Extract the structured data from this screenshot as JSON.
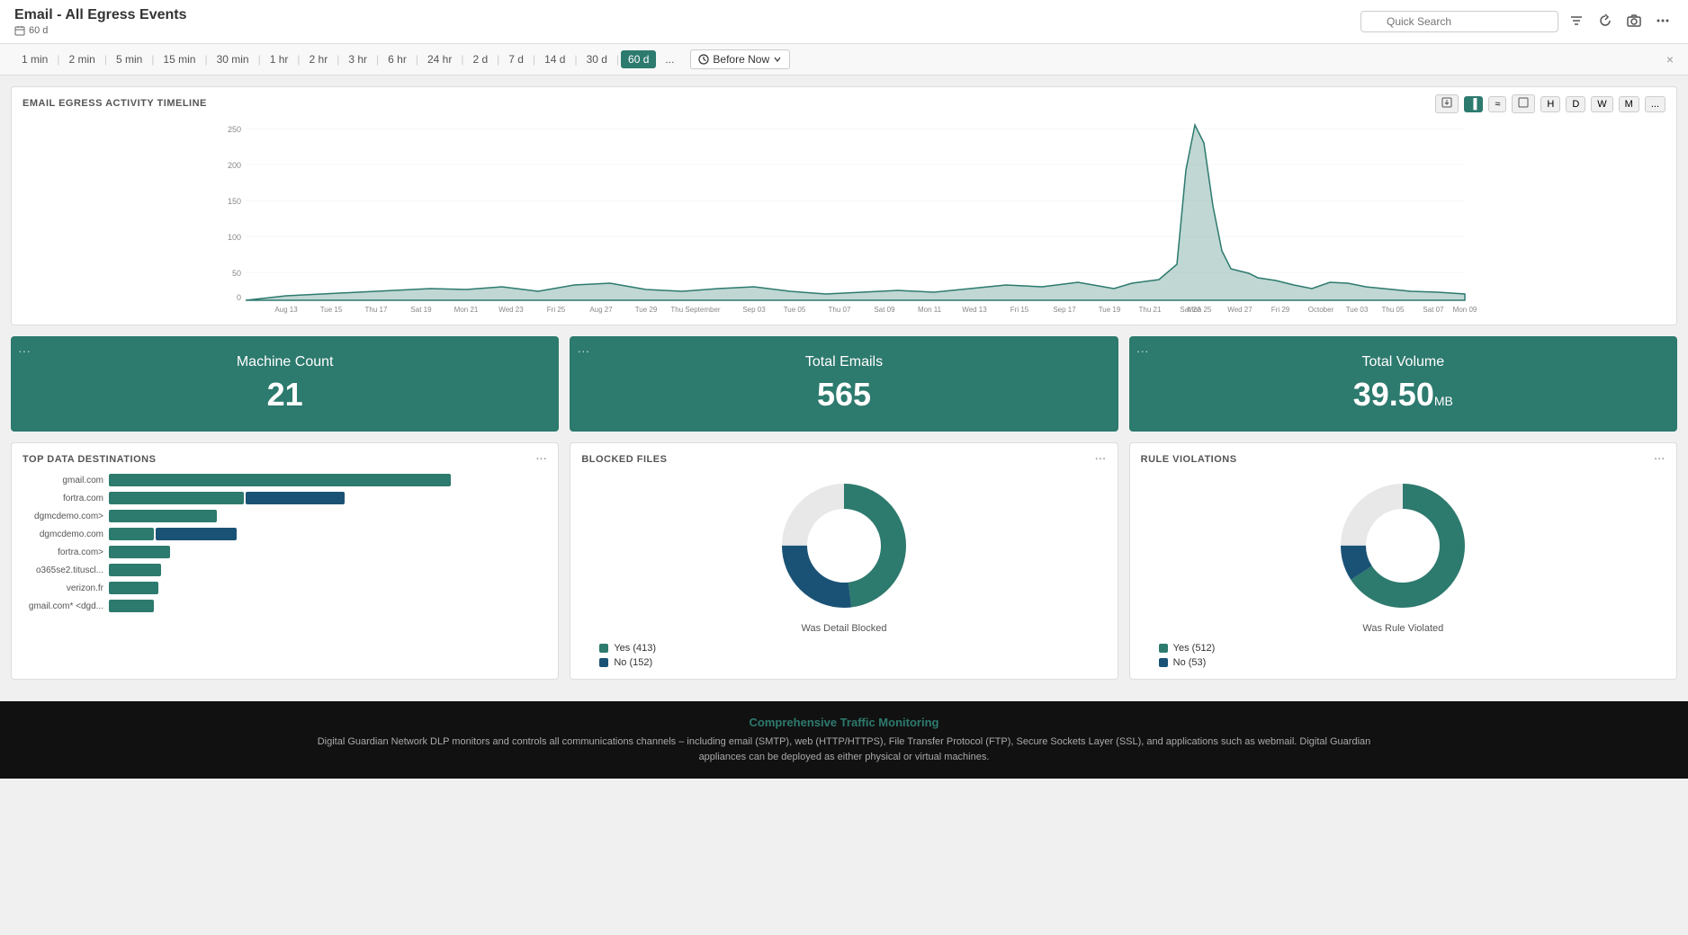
{
  "header": {
    "title": "Email - All Egress Events",
    "subtitle": "60 d",
    "search_placeholder": "Quick Search",
    "icons": [
      "filter-icon",
      "refresh-icon",
      "camera-icon",
      "more-icon"
    ]
  },
  "timebar": {
    "buttons": [
      "1 min",
      "2 min",
      "5 min",
      "15 min",
      "30 min",
      "1 hr",
      "2 hr",
      "3 hr",
      "6 hr",
      "24 hr",
      "2 d",
      "7 d",
      "14 d",
      "30 d",
      "60 d"
    ],
    "active": "60 d",
    "more_label": "...",
    "before_now_label": "Before Now",
    "close_label": "×"
  },
  "timeline_chart": {
    "title": "EMAIL EGRESS ACTIVITY TIMELINE",
    "y_labels": [
      "250",
      "200",
      "150",
      "100",
      "50",
      "0"
    ],
    "x_labels": [
      "Aug 13",
      "Tue 15",
      "Thu 17",
      "Sat 19",
      "Mon 21",
      "Wed 23",
      "Fri 25",
      "Aug 27",
      "Tue 29",
      "Thu September",
      "Sep 03",
      "Tue 05",
      "Thu 07",
      "Sat 09",
      "Mon 11",
      "Wed 13",
      "Fri 15",
      "Sep 17",
      "Tue 19",
      "Thu 21",
      "Sat 23",
      "Mon 25",
      "Wed 27",
      "Fri 29",
      "October",
      "Tue 03",
      "Thu 05",
      "Sat 07",
      "Mon 09"
    ],
    "controls": {
      "btns": [
        "H",
        "D",
        "W",
        "M"
      ],
      "active": "H"
    }
  },
  "stats": [
    {
      "label": "Machine Count",
      "value": "21",
      "unit": ""
    },
    {
      "label": "Total Emails",
      "value": "565",
      "unit": ""
    },
    {
      "label": "Total Volume",
      "value": "39.50",
      "unit": "MB"
    }
  ],
  "panels": {
    "destinations": {
      "title": "TOP DATA DESTINATIONS",
      "bars": [
        {
          "label": "gmail.com",
          "teal": 85,
          "blue": 0
        },
        {
          "label": "fortra.com",
          "teal": 35,
          "blue": 25
        },
        {
          "label": "dgmcdemo.com>",
          "teal": 28,
          "blue": 0
        },
        {
          "label": "dgmcdemo.com",
          "teal": 12,
          "blue": 20
        },
        {
          "label": "fortra.com>",
          "teal": 16,
          "blue": 0
        },
        {
          "label": "o365se2.tituscl...",
          "teal": 14,
          "blue": 0
        },
        {
          "label": "verizon.fr",
          "teal": 14,
          "blue": 0
        },
        {
          "label": "gmail.com* <dgd...",
          "teal": 12,
          "blue": 0
        }
      ]
    },
    "blocked_files": {
      "title": "BLOCKED FILES",
      "donut_label": "Was Detail Blocked",
      "yes_label": "Yes (413)",
      "no_label": "No (152)",
      "yes_value": 413,
      "no_value": 152
    },
    "rule_violations": {
      "title": "RULE VIOLATIONS",
      "donut_label": "Was Rule Violated",
      "yes_label": "Yes (512)",
      "no_label": "No (53)",
      "yes_value": 512,
      "no_value": 53
    }
  },
  "footer": {
    "title": "Comprehensive Traffic Monitoring",
    "text": "Digital Guardian Network DLP monitors and controls all communications channels – including email (SMTP), web (HTTP/HTTPS), File Transfer Protocol (FTP), Secure Sockets Layer (SSL), and applications such as webmail. Digital Guardian appliances can be deployed as either physical or virtual machines."
  }
}
